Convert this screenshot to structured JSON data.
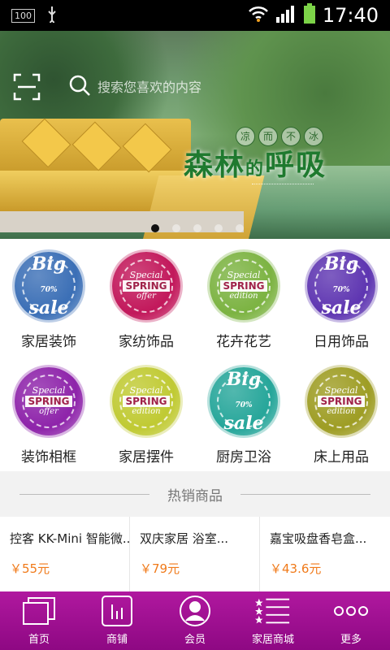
{
  "status_bar": {
    "battery_badge": "100",
    "time": "17:40"
  },
  "search": {
    "placeholder": "搜索您喜欢的内容"
  },
  "banner": {
    "slogan_circles": [
      "凉",
      "而",
      "不",
      "冰"
    ],
    "slogan_main": "森林",
    "slogan_de": "的",
    "slogan_end": "呼吸",
    "dots": 5,
    "active_dot": 0
  },
  "categories": [
    {
      "label": "家居装饰",
      "badge": "Big 70% sale",
      "color": "#3b6fb6"
    },
    {
      "label": "家纺饰品",
      "badge": "Special SPRING offer",
      "color": "#c2185b"
    },
    {
      "label": "花卉花艺",
      "badge": "Special SPRING edition",
      "color": "#7cb342"
    },
    {
      "label": "日用饰品",
      "badge": "Big 70% sale",
      "color": "#5e35b1"
    },
    {
      "label": "装饰相框",
      "badge": "Special SPRING offer",
      "color": "#8e24aa"
    },
    {
      "label": "家居摆件",
      "badge": "Special SPRING edition",
      "color": "#c0ca33"
    },
    {
      "label": "厨房卫浴",
      "badge": "Big 70% sale",
      "color": "#26a69a"
    },
    {
      "label": "床上用品",
      "badge": "Special SPRING edition",
      "color": "#9e9d24"
    }
  ],
  "hot_section": {
    "title": "热销商品"
  },
  "products": [
    {
      "name": "控客 KK-Mini 智能微...",
      "price": "￥55元"
    },
    {
      "name": "双庆家居 浴室...",
      "price": "￥79元"
    },
    {
      "name": "嘉宝吸盘香皂盒...",
      "price": "￥43.6元"
    }
  ],
  "tabs": [
    {
      "label": "首页",
      "icon": "home-icon"
    },
    {
      "label": "商铺",
      "icon": "shop-icon"
    },
    {
      "label": "会员",
      "icon": "member-icon"
    },
    {
      "label": "家居商城",
      "icon": "list-icon"
    },
    {
      "label": "更多",
      "icon": "more-icon"
    }
  ],
  "colors": {
    "tabbar": "#a3128f",
    "price": "#f07a1a"
  }
}
